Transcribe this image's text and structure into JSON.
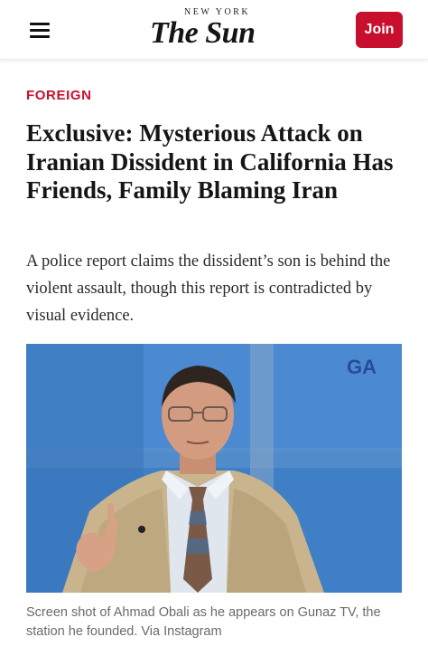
{
  "header": {
    "logo_top": "NEW YORK",
    "logo_main": "The Sun",
    "join_label": "Join",
    "brand_color": "#c8102e"
  },
  "article": {
    "category": "FOREIGN",
    "headline": "Exclusive: Mysterious Attack on Iranian Dissident in California Has Friends, Family Blaming Iran",
    "dek": "A police report claims the dissident’s son is behind the violent assault, though this report is contradicted by visual evidence.",
    "image_watermark": "GA",
    "caption": "Screen shot of Ahmad Obali as he appears on Gunaz TV, the station he founded. Via Instagram"
  }
}
